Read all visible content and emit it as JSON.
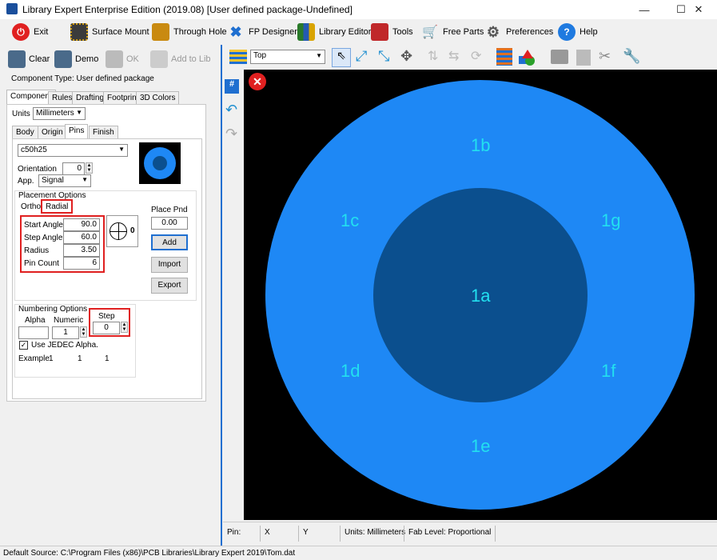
{
  "window": {
    "title": "Library Expert Enterprise Edition (2019.08) [User defined package-Undefined]",
    "minimize": "—",
    "maximize": "☐",
    "close": "✕"
  },
  "mainbar": {
    "exit": "Exit",
    "surface_mount": "Surface Mount",
    "through_hole": "Through Hole",
    "fp_designer": "FP Designer",
    "library_editor": "Library Editor",
    "tools": "Tools",
    "free_parts": "Free Parts",
    "preferences": "Preferences",
    "help": "Help"
  },
  "left_toolbar": {
    "clear": "Clear",
    "demo": "Demo",
    "ok": "OK",
    "add_to_lib": "Add to Lib"
  },
  "component_type": "Component Type: User defined package",
  "tabs": [
    "Component",
    "Rules",
    "Drafting",
    "Footprint",
    "3D Colors"
  ],
  "units": {
    "label": "Units",
    "value": "Millimeters"
  },
  "subtabs": [
    "Body",
    "Origin",
    "Pins",
    "Finish"
  ],
  "pin": {
    "padstack": "c50h25",
    "orientation_label": "Orientation",
    "orientation": "0",
    "app_label": "App.",
    "app": "Signal"
  },
  "placement": {
    "title": "Placement Options",
    "tab_ortho": "Ortho",
    "tab_radial": "Radial",
    "start_angle_label": "Start Angle",
    "start_angle": "90.0",
    "step_angle_label": "Step Angle",
    "step_angle": "60.0",
    "radius_label": "Radius",
    "radius": "3.50",
    "pin_count_label": "Pin Count",
    "pin_count": "6",
    "dir_value": "0",
    "place_pnd_label": "Place Pnd",
    "place_pnd": "0.00",
    "add": "Add",
    "import": "Import",
    "export": "Export"
  },
  "numbering": {
    "title": "Numbering Options",
    "alpha_label": "Alpha",
    "numeric_label": "Numeric",
    "step_label": "Step",
    "alpha": "",
    "numeric": "1",
    "step": "0",
    "jedec": "Use JEDEC Alpha.",
    "example_label": "Example",
    "ex1": "1",
    "ex2": "1",
    "ex3": "1"
  },
  "view": {
    "layer": "Top"
  },
  "pins": [
    {
      "label": "1a"
    },
    {
      "label": "1b"
    },
    {
      "label": "1c"
    },
    {
      "label": "1d"
    },
    {
      "label": "1e"
    },
    {
      "label": "1f"
    },
    {
      "label": "1g"
    }
  ],
  "status": {
    "pin": "Pin:",
    "x": "X",
    "y": "Y",
    "units": "Units: Millimeters",
    "fab": "Fab Level: Proportional"
  },
  "default_source": "Default Source:  C:\\Program Files (x86)\\PCB Libraries\\Library Expert 2019\\Tom.dat",
  "colors": {
    "outer_pad": "#1e88f5",
    "inner_pad": "#0b4f8e",
    "pin_text": "#22e0f0"
  }
}
